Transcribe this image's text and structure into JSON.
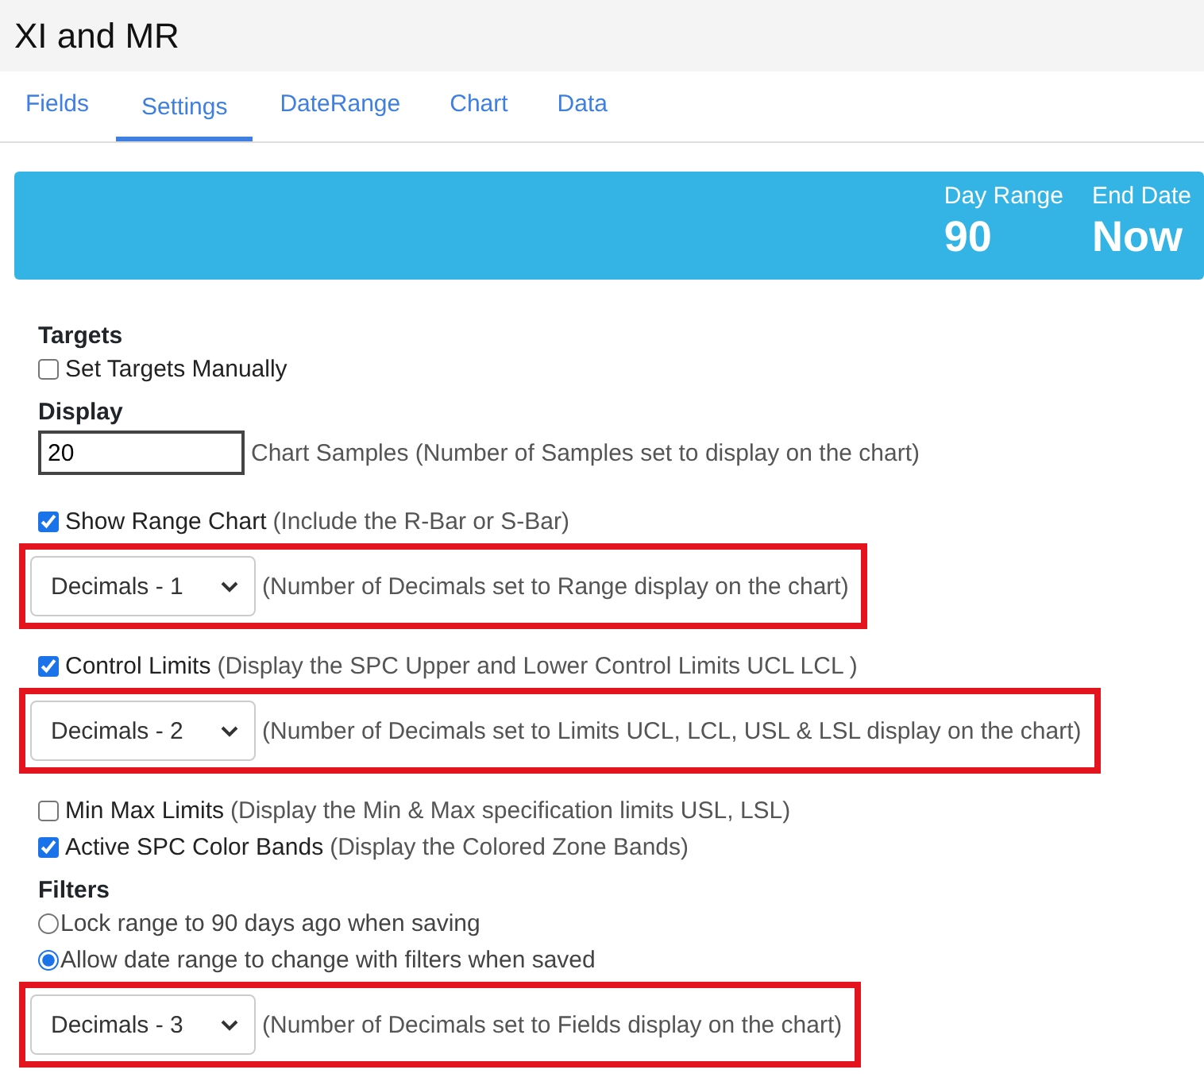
{
  "window": {
    "title": "XI and MR"
  },
  "tabs": [
    {
      "label": "Fields",
      "selected": false
    },
    {
      "label": "Settings",
      "selected": true
    },
    {
      "label": "DateRange",
      "selected": false
    },
    {
      "label": "Chart",
      "selected": false
    },
    {
      "label": "Data",
      "selected": false
    }
  ],
  "banner": {
    "stats": [
      {
        "label": "Day Range",
        "value": "90"
      },
      {
        "label": "End Date",
        "value": "Now"
      }
    ]
  },
  "items": [
    {
      "kind": "heading",
      "text": "Targets"
    },
    {
      "kind": "checkbox",
      "label": "Set Targets Manually",
      "checked": false
    },
    {
      "kind": "heading",
      "text": "Display"
    },
    {
      "kind": "number",
      "value": "20",
      "note": "Chart Samples (Number of Samples set to display on the chart)"
    },
    {
      "kind": "checkbox",
      "label": "Show Range Chart",
      "note": "(Include the R-Bar or S-Bar)",
      "checked": true
    },
    {
      "kind": "select",
      "value": "Decimals - 1",
      "note": "(Number of Decimals set to Range display on the chart)",
      "highlighted": true
    },
    {
      "kind": "checkbox",
      "label": "Control Limits",
      "note": "(Display the SPC Upper and Lower Control Limits UCL LCL )",
      "checked": true
    },
    {
      "kind": "select",
      "value": "Decimals - 2",
      "note": "(Number of Decimals set to Limits UCL, LCL, USL & LSL display on the chart)",
      "highlighted": true
    },
    {
      "kind": "checkbox",
      "label": "Min Max Limits",
      "note": "(Display the Min & Max specification limits USL, LSL)",
      "checked": false
    },
    {
      "kind": "checkbox",
      "label": "Active SPC Color Bands",
      "note": "(Display the Colored Zone Bands)",
      "checked": true
    },
    {
      "kind": "heading",
      "text": "Filters"
    },
    {
      "kind": "radio",
      "label": "Lock range to 90 days ago when saving",
      "selected": false
    },
    {
      "kind": "radio",
      "label": "Allow date range to change with filters when saved",
      "selected": true
    },
    {
      "kind": "select",
      "value": "Decimals - 3",
      "note": "(Number of Decimals set to Fields display on the chart)",
      "highlighted": true
    }
  ]
}
